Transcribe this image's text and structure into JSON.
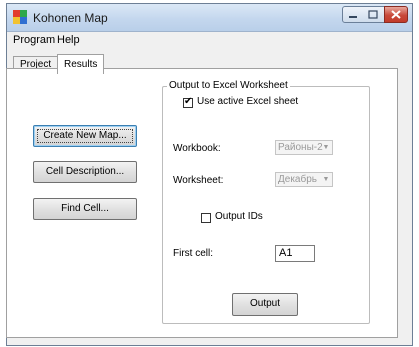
{
  "window": {
    "title": "Kohonen Map"
  },
  "menu": {
    "items": [
      "Program",
      "Help"
    ]
  },
  "tabs": [
    "Project",
    "Results"
  ],
  "buttons": {
    "create_new_map": "Create New Map...",
    "cell_description": "Cell Description...",
    "find_cell": "Find Cell...",
    "output": "Output"
  },
  "excel_group": {
    "title": "Output to Excel Worksheet",
    "use_active_sheet_label": "Use active Excel sheet",
    "use_active_sheet_checked": true,
    "workbook_label": "Workbook:",
    "workbook_value": "Районы-2",
    "worksheet_label": "Worksheet:",
    "worksheet_value": "Декабрь",
    "output_ids_label": "Output IDs",
    "output_ids_checked": false,
    "first_cell_label": "First cell:",
    "first_cell_value": "A1"
  }
}
